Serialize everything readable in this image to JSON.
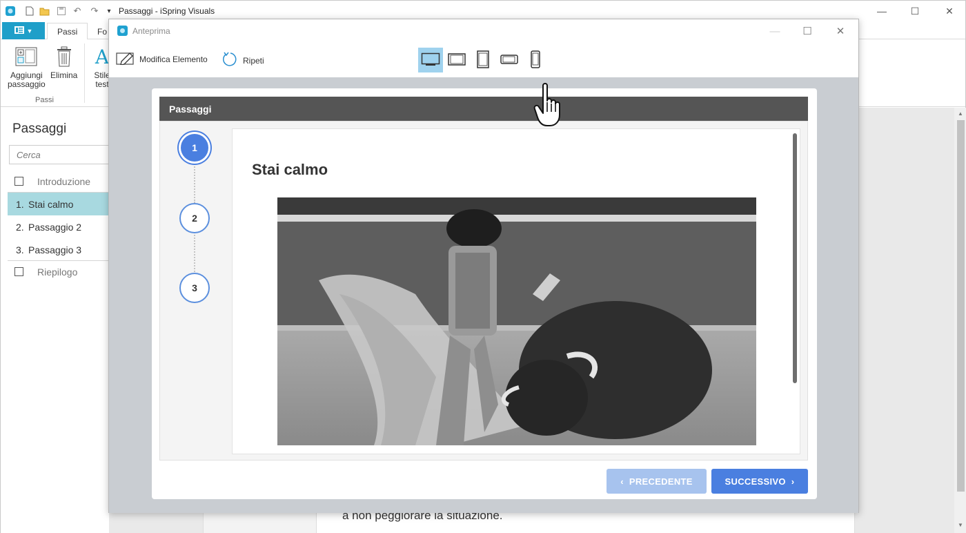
{
  "app": {
    "title": "Passaggi - iSpring Visuals",
    "tabs": [
      {
        "label": "Passi"
      },
      {
        "label": "Fo"
      }
    ],
    "ribbon": {
      "add_step_label": "Aggiungi passaggio",
      "add_step_line1": "Aggiungi",
      "add_step_line2": "passaggio",
      "delete_label": "Elimina",
      "text_style_line1": "Stile",
      "text_style_line2": "test",
      "group_label": "Passi"
    }
  },
  "left_panel": {
    "title": "Passaggi",
    "search_placeholder": "Cerca",
    "items": [
      {
        "num": "",
        "label": "Introduzione"
      },
      {
        "num": "1.",
        "label": "Stai calmo"
      },
      {
        "num": "2.",
        "label": "Passaggio 2"
      },
      {
        "num": "3.",
        "label": "Passaggio 3"
      },
      {
        "num": "",
        "label": "Riepilogo"
      }
    ]
  },
  "canvas": {
    "visible_text": "a non peggiorare la situazione."
  },
  "dialog": {
    "title": "Anteprima",
    "toolbar": {
      "edit_label": "Modifica Elemento",
      "replay_label": "Ripeti"
    },
    "devices": [
      "desktop-icon",
      "tablet-landscape-icon",
      "tablet-portrait-icon",
      "phone-landscape-icon",
      "phone-portrait-icon"
    ],
    "player": {
      "header": "Passaggi",
      "steps": [
        "1",
        "2",
        "3"
      ],
      "current_step": 1,
      "slide_title": "Stai calmo",
      "prev_label": "PRECEDENTE",
      "next_label": "SUCCESSIVO"
    }
  },
  "colors": {
    "accent": "#1f9fc9",
    "selection": "#a8d9e0",
    "player_blue": "#4a7fe0",
    "player_blue_disabled": "#a7c3ee",
    "player_header": "#555555"
  }
}
